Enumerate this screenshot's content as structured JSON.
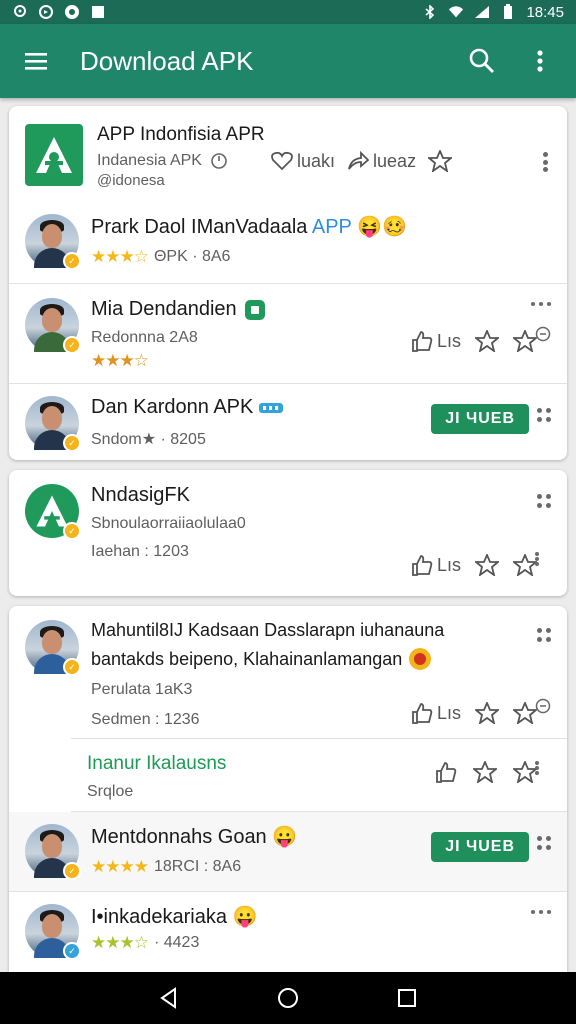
{
  "status_bar": {
    "time": "18:45"
  },
  "app_bar": {
    "title": "Download APK"
  },
  "header_app": {
    "title": "APP Indonfisia APR",
    "subtitle": "Indanesia APK",
    "subtitle2": "@idonesa",
    "like_label": "luakı",
    "share_label": "lueaz"
  },
  "cards": [
    {
      "items": [
        {
          "name": "Prark Daol IManVadaala",
          "name_highlight": "APP",
          "emoji": "😝🥴",
          "stars": "★★★☆",
          "meta": "ΘPK · 8A6"
        },
        {
          "name": "Mia Dendandien",
          "sub": "Redonnna 2A8",
          "stars": "★★★☆",
          "like_label": "Lıs"
        },
        {
          "name": "Dan Kardonn APK",
          "sub": "Sndom★ · 8205",
          "button": "JI ЧUEB"
        }
      ]
    },
    {
      "items": [
        {
          "name": "NndasigFK",
          "sub": "Sbnoulaorraiiaolulaa0",
          "meta": "Iaehan : 1203",
          "like_label": "Lıs"
        }
      ]
    },
    {
      "items": [
        {
          "name_line1": "Mahuntil8IJ Kadsaan Dasslarapn iuhanauna",
          "name_line2": "bantakds beipeno, Klahainanlamangan",
          "sub": "Perulata 1aK3",
          "meta": "Sedmen : 1236",
          "like_label": "Lıs"
        },
        {
          "name": "Inanur Ikalausns",
          "sub": "Srqloe"
        },
        {
          "name": "Mentdonnahs Goan",
          "emoji": "😛",
          "stars": "★★★★",
          "meta": "18RCI : 8A6",
          "button": "JI ЧUEB"
        },
        {
          "name": "I•inkadekariaka",
          "emoji": "😛",
          "stars": "★★★☆",
          "meta": "· 4423"
        }
      ]
    }
  ]
}
